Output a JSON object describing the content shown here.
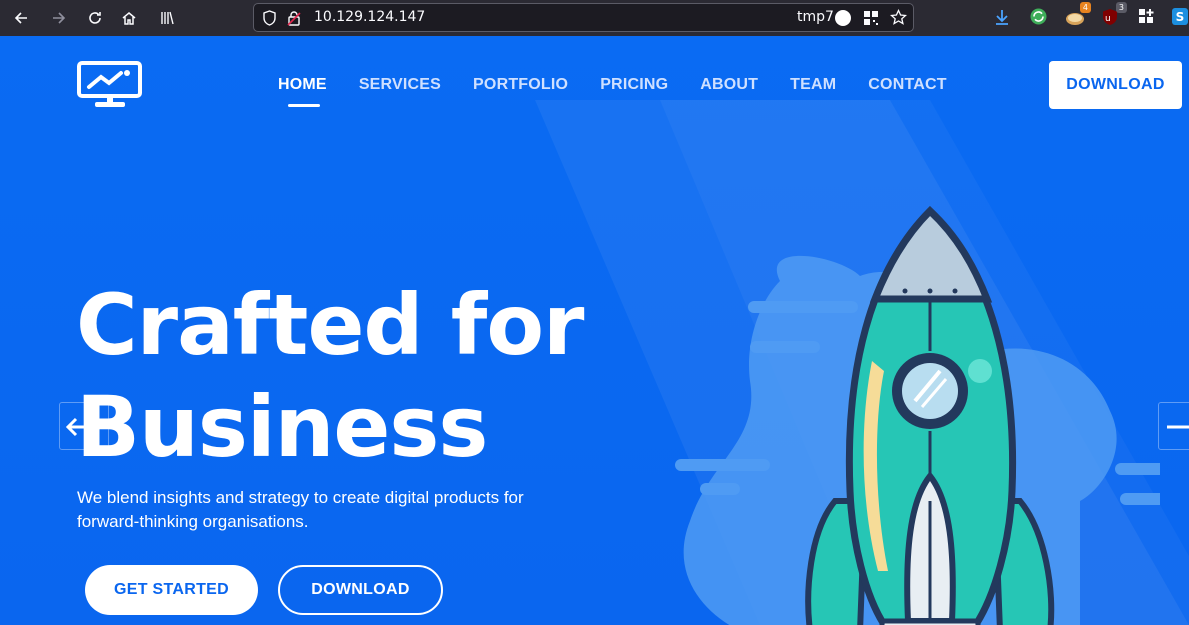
{
  "browser": {
    "url": "10.129.124.147",
    "container": "tmp7",
    "extensions": [
      {
        "name": "download-icon"
      },
      {
        "name": "sync-extension-icon"
      },
      {
        "name": "cookie-extension-icon",
        "badge": "4"
      },
      {
        "name": "ublock-icon",
        "badge": "3"
      },
      {
        "name": "extensions-grid-icon"
      },
      {
        "name": "s-extension-icon"
      }
    ]
  },
  "nav": {
    "items": [
      {
        "label": "HOME",
        "active": true
      },
      {
        "label": "SERVICES"
      },
      {
        "label": "PORTFOLIO"
      },
      {
        "label": "PRICING"
      },
      {
        "label": "ABOUT"
      },
      {
        "label": "TEAM"
      },
      {
        "label": "CONTACT"
      }
    ],
    "download_label": "DOWNLOAD"
  },
  "hero": {
    "title_line1": "Crafted for",
    "title_line2": "Business",
    "subtitle": "We blend insights and strategy to create digital products for forward-thinking organisations.",
    "primary_button": "GET STARTED",
    "secondary_button": "DOWNLOAD"
  },
  "colors": {
    "background": "#0b6cf5",
    "accent": "#0a66ef",
    "rocket_body": "#26c6b5",
    "rocket_outline": "#23395d"
  }
}
